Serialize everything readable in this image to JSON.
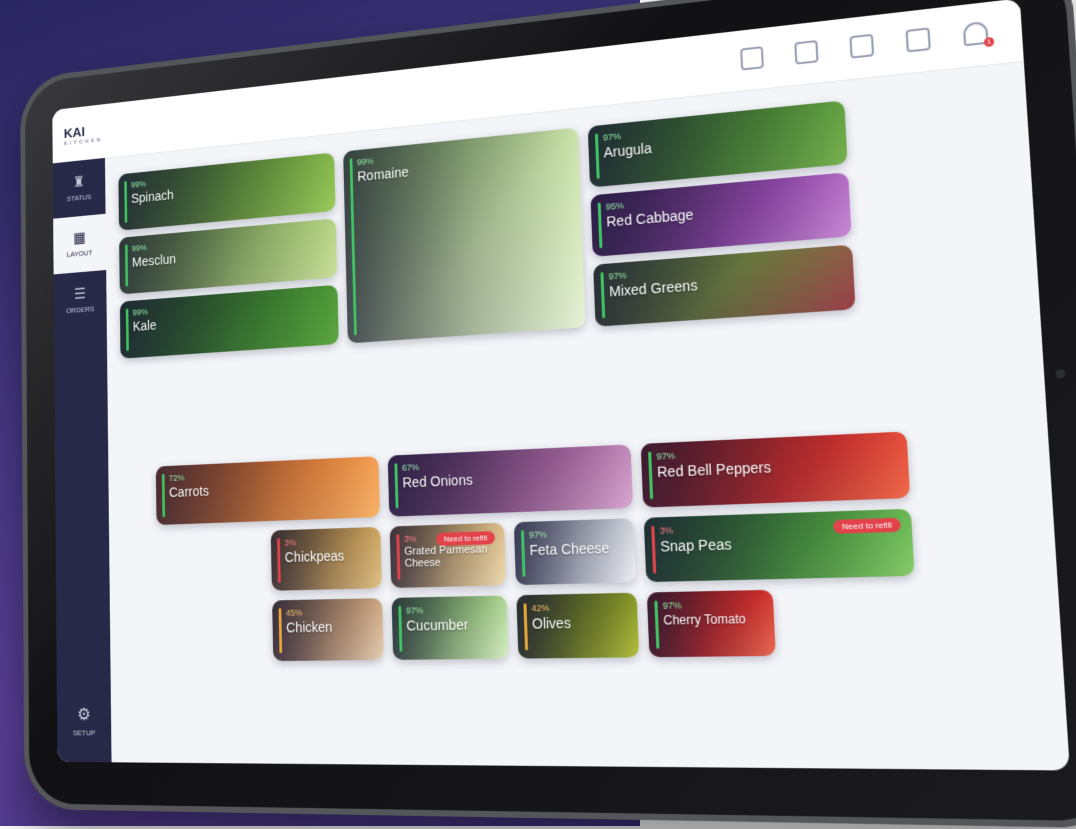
{
  "app": {
    "logo_text": "KAI",
    "logo_sub": "KITCHEN"
  },
  "topbar_icons": [
    "printer-icon",
    "wifi-icon",
    "database-icon",
    "folder-icon",
    "bell-icon"
  ],
  "notification_count": "1",
  "sidebar": {
    "items": [
      {
        "label": "STATUS",
        "icon": "robot-icon"
      },
      {
        "label": "LAYOUT",
        "icon": "grid-icon"
      },
      {
        "label": "ORDERS",
        "icon": "list-icon"
      }
    ],
    "setup_label": "SETUP"
  },
  "colors": {
    "ok": "#40c463",
    "low": "#e7a83a",
    "critical": "#e2434b",
    "sidebar": "#262a48"
  },
  "refill_label": "Need to refill",
  "greens": [
    {
      "name": "Spinach",
      "pct": "99%"
    },
    {
      "name": "Mesclun",
      "pct": "99%"
    },
    {
      "name": "Kale",
      "pct": "99%"
    },
    {
      "name": "Romaine",
      "pct": "99%"
    },
    {
      "name": "Arugula",
      "pct": "97%"
    },
    {
      "name": "Red Cabbage",
      "pct": "95%"
    },
    {
      "name": "Mixed Greens",
      "pct": "97%"
    }
  ],
  "toppings": [
    {
      "name": "Carrots",
      "pct": "72%"
    },
    {
      "name": "Red Onions",
      "pct": "67%"
    },
    {
      "name": "Red Bell Peppers",
      "pct": "97%"
    },
    {
      "name": "Chickpeas",
      "pct": "3%"
    },
    {
      "name": "Grated Parmesan Cheese",
      "pct": "3%"
    },
    {
      "name": "Feta Cheese",
      "pct": "97%"
    },
    {
      "name": "Snap Peas",
      "pct": "3%"
    },
    {
      "name": "Chicken",
      "pct": "45%"
    },
    {
      "name": "Cucumber",
      "pct": "97%"
    },
    {
      "name": "Olives",
      "pct": "42%"
    },
    {
      "name": "Cherry Tomato",
      "pct": "97%"
    }
  ]
}
